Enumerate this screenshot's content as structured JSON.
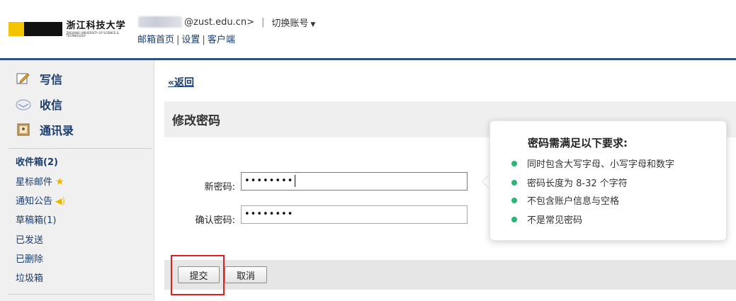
{
  "header": {
    "logo_text": "浙江科技大学",
    "logo_subtext": "ZHEJIANG UNIVERSITY OF SCIENCE & TECHNOLOGY",
    "account_suffix": "@zust.edu.cn>",
    "separator": "|",
    "switch_account": "切换账号",
    "links": [
      "邮箱首页",
      "设置",
      "客户端"
    ]
  },
  "sidebar": {
    "main_items": [
      {
        "label": "写信",
        "icon": "compose-icon"
      },
      {
        "label": "收信",
        "icon": "inbox-icon"
      },
      {
        "label": "通讯录",
        "icon": "contacts-icon"
      }
    ],
    "folders": [
      {
        "label": "收件箱(2)"
      },
      {
        "label": "星标邮件"
      },
      {
        "label": "通知公告"
      },
      {
        "label": "草稿箱(1)"
      },
      {
        "label": "已发送"
      },
      {
        "label": "已删除"
      },
      {
        "label": "垃圾箱"
      }
    ]
  },
  "main": {
    "back_link": "«返回",
    "title": "修改密码",
    "new_password_label": "新密码:",
    "new_password_value": "••••••••",
    "confirm_password_label": "确认密码:",
    "confirm_password_value": "••••••••",
    "submit_label": "提交",
    "cancel_label": "取消"
  },
  "tooltip": {
    "title": "密码需满足以下要求:",
    "items": [
      "同时包含大写字母、小写字母和数字",
      "密码长度为 8-32 个字符",
      "不包含账户信息与空格",
      "不是常见密码"
    ],
    "bullet_color": "#2bb673"
  },
  "colors": {
    "header_line": "#2f4f7c",
    "link": "#1a3d6d",
    "highlight": "#e02020"
  }
}
